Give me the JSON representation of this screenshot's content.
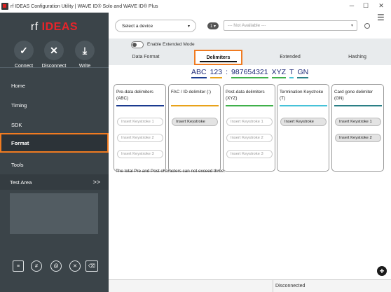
{
  "window": {
    "title": "rf IDEAS Configuration Utility | WAVE ID® Solo and WAVE ID® Plus",
    "minimize": "─",
    "maximize": "☐",
    "close": "✕"
  },
  "sidebar": {
    "logo_rf": "rf",
    "logo_ideas": "IDEAS",
    "quick_actions": [
      {
        "label": "Connect",
        "icon": "✓"
      },
      {
        "label": "Disconnect",
        "icon": "✕"
      },
      {
        "label": "Write",
        "icon": "⤓"
      }
    ],
    "nav": [
      {
        "label": "Home"
      },
      {
        "label": "Timing"
      },
      {
        "label": "SDK"
      },
      {
        "label": "Format"
      },
      {
        "label": "Tools"
      }
    ],
    "test_area": {
      "label": "Test Area",
      "chevron": ">>"
    },
    "bottom_icons": [
      {
        "name": "notes-icon",
        "glyph": "≡"
      },
      {
        "name": "hash-icon",
        "glyph": "#"
      },
      {
        "name": "at-icon",
        "glyph": "@"
      },
      {
        "name": "clear-icon",
        "glyph": "✕"
      },
      {
        "name": "backspace-icon",
        "glyph": "⌫"
      }
    ]
  },
  "header": {
    "device_select": "Select a device",
    "device_caret": "▾",
    "port_badge": "1 ▾",
    "port_select": "--- Not Available ---",
    "port_caret": "▾",
    "menu_icon": "☰"
  },
  "tabs": {
    "toggle_label": "Enable Extended Mode",
    "items": [
      {
        "label": "Data Format"
      },
      {
        "label": "Delimiters"
      },
      {
        "label": "Extended"
      },
      {
        "label": "Hashing"
      }
    ]
  },
  "example": {
    "segments": [
      {
        "text": "ABC",
        "color": "#1a3a8f"
      },
      {
        "text": "123",
        "color": "#e8a21a"
      },
      {
        "text": ":",
        "color": null
      },
      {
        "text": "987654321",
        "color": "#3fb04a"
      },
      {
        "text": "XYZ",
        "color": "#3fb04a"
      },
      {
        "text": "T",
        "color": "#46c2d8"
      },
      {
        "text": "GN",
        "color": "#2a7f86"
      }
    ]
  },
  "cards": [
    {
      "title": "Pre-data delimiters (ABC)",
      "color": "#1a3a8f",
      "keystrokes": [
        {
          "label": "Insert Keystroke 1",
          "filled": false
        },
        {
          "label": "Insert Keystroke 2",
          "filled": false
        },
        {
          "label": "Insert Keystroke 3",
          "filled": false
        }
      ]
    },
    {
      "title": "FAC / ID delimiter (:)",
      "color": "#e8a21a",
      "keystrokes": [
        {
          "label": "Insert Keystroke",
          "filled": true
        }
      ]
    },
    {
      "title": "Post-data delimiters (XYZ)",
      "color": "#3fb04a",
      "keystrokes": [
        {
          "label": "Insert Keystroke 1",
          "filled": false
        },
        {
          "label": "Insert Keystroke 2",
          "filled": false
        },
        {
          "label": "Insert Keystroke 3",
          "filled": false
        }
      ]
    },
    {
      "title": "Termination Keystroke (T)",
      "color": "#46c2d8",
      "keystrokes": [
        {
          "label": "Insert Keystroke",
          "filled": true
        }
      ]
    },
    {
      "title": "Card gone delimiter (GN)",
      "color": "#2a7f86",
      "keystrokes": [
        {
          "label": "Insert Keystroke 1",
          "filled": true
        },
        {
          "label": "Insert Keystroke 2",
          "filled": true
        }
      ]
    }
  ],
  "note": "The total Pre and Post characters can not exceed three.",
  "add_button": "+",
  "status": {
    "text": "Disconnected"
  }
}
